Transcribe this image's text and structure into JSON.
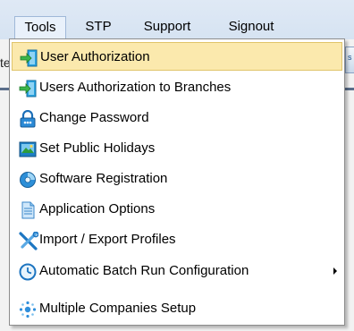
{
  "menubar": {
    "items": [
      {
        "label": "Tools",
        "active": true
      },
      {
        "label": "STP"
      },
      {
        "label": "Support"
      },
      {
        "label": "Signout"
      }
    ]
  },
  "background": {
    "left_fragment": "te",
    "right_fragment": "s"
  },
  "tools_menu": {
    "items": [
      {
        "label": "User Authorization",
        "icon": "enter-arrow-icon",
        "highlighted": true
      },
      {
        "label": "Users Authorization to Branches",
        "icon": "enter-arrow-icon"
      },
      {
        "label": "Change Password",
        "icon": "lock-icon"
      },
      {
        "label": "Set Public Holidays",
        "icon": "calendar-picture-icon"
      },
      {
        "label": "Software Registration",
        "icon": "disc-icon"
      },
      {
        "label": "Application Options",
        "icon": "document-icon"
      },
      {
        "label": "Import / Export Profiles",
        "icon": "tools-icon"
      },
      {
        "label": "Automatic Batch Run Configuration",
        "icon": "clock-icon",
        "submenu": true
      },
      {
        "label": "Multiple Companies Setup",
        "icon": "network-icon"
      }
    ]
  },
  "colors": {
    "highlight_bg": "#fbe9ad",
    "highlight_border": "#e0c46a",
    "menubar_bg": "#dfe9f5"
  }
}
